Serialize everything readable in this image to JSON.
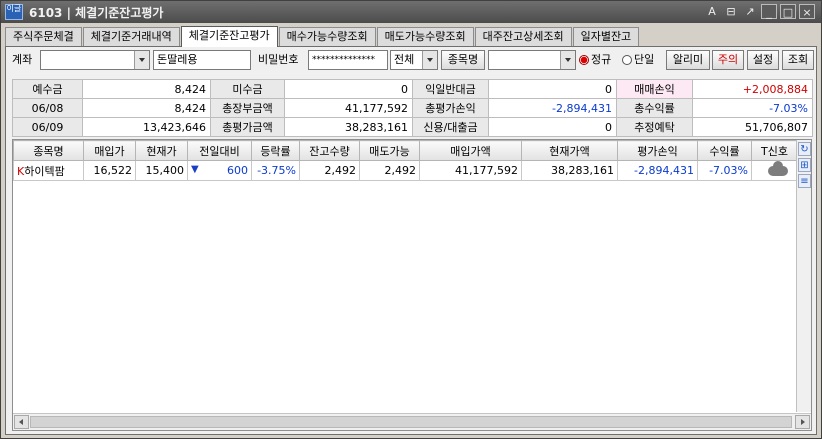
{
  "window": {
    "title": "6103 | 체결기준잔고평가",
    "icon_text": "이글",
    "buttons": [
      "A",
      "⊟",
      "↗",
      "_",
      "□",
      "×"
    ]
  },
  "tabs": [
    {
      "label": "주식주문체결",
      "active": false
    },
    {
      "label": "체결기준거래내역",
      "active": false
    },
    {
      "label": "체결기준잔고평가",
      "active": true
    },
    {
      "label": "매수가능수량조회",
      "active": false
    },
    {
      "label": "매도가능수량조회",
      "active": false
    },
    {
      "label": "대주잔고상세조회",
      "active": false
    },
    {
      "label": "일자별잔고",
      "active": false
    }
  ],
  "account": {
    "account_label": "계좌",
    "account_value": "",
    "holder_name": "돈딸레용",
    "password_label": "비밀번호",
    "password_value": "**************",
    "scope_value": "전체",
    "stock_button": "종목명",
    "stock_value": "",
    "radio_regular": "정규",
    "radio_single": "단일",
    "alarm_button": "알리미",
    "caution_button": "주의",
    "settings_button": "설정",
    "query_button": "조회"
  },
  "summary": {
    "rows": [
      [
        {
          "text": "예수금",
          "kind": "h"
        },
        {
          "text": "8,424",
          "kind": "v"
        },
        {
          "text": "미수금",
          "kind": "h"
        },
        {
          "text": "0",
          "kind": "v"
        },
        {
          "text": "익일반대금",
          "kind": "h"
        },
        {
          "text": "0",
          "kind": "v"
        },
        {
          "text": "매매손익",
          "kind": "hp"
        },
        {
          "text": "+2,008,884",
          "kind": "v",
          "tone": "pos"
        }
      ],
      [
        {
          "text": "06/08",
          "kind": "h"
        },
        {
          "text": "8,424",
          "kind": "v"
        },
        {
          "text": "총장부금액",
          "kind": "h"
        },
        {
          "text": "41,177,592",
          "kind": "v"
        },
        {
          "text": "총평가손익",
          "kind": "h"
        },
        {
          "text": "-2,894,431",
          "kind": "v",
          "tone": "neg"
        },
        {
          "text": "총수익률",
          "kind": "h"
        },
        {
          "text": "-7.03%",
          "kind": "v",
          "tone": "neg"
        }
      ],
      [
        {
          "text": "06/09",
          "kind": "h"
        },
        {
          "text": "13,423,646",
          "kind": "v"
        },
        {
          "text": "총평가금액",
          "kind": "h"
        },
        {
          "text": "38,283,161",
          "kind": "v"
        },
        {
          "text": "신용/대출금",
          "kind": "h"
        },
        {
          "text": "0",
          "kind": "v"
        },
        {
          "text": "추정예탁",
          "kind": "h"
        },
        {
          "text": "51,706,807",
          "kind": "v"
        }
      ]
    ]
  },
  "holdings": {
    "columns": [
      "종목명",
      "매입가",
      "현재가",
      "전일대비",
      "등락률",
      "잔고수량",
      "매도가능",
      "매입가액",
      "현재가액",
      "평가손익",
      "수익률",
      "T신호"
    ],
    "rows": [
      {
        "market_mark": "K",
        "name": "하이텍팜",
        "buy_price": "16,522",
        "cur_price": "15,400",
        "change_arrow": "▼",
        "change": "600",
        "change_rate": "-3.75%",
        "qty": "2,492",
        "sellable": "2,492",
        "buy_amount": "41,177,592",
        "cur_amount": "38,283,161",
        "pnl": "-2,894,431",
        "return": "-7.03%",
        "signal_icon": "cloud-icon"
      }
    ]
  },
  "side_tools": [
    "↻",
    "⊞",
    "≡"
  ]
}
